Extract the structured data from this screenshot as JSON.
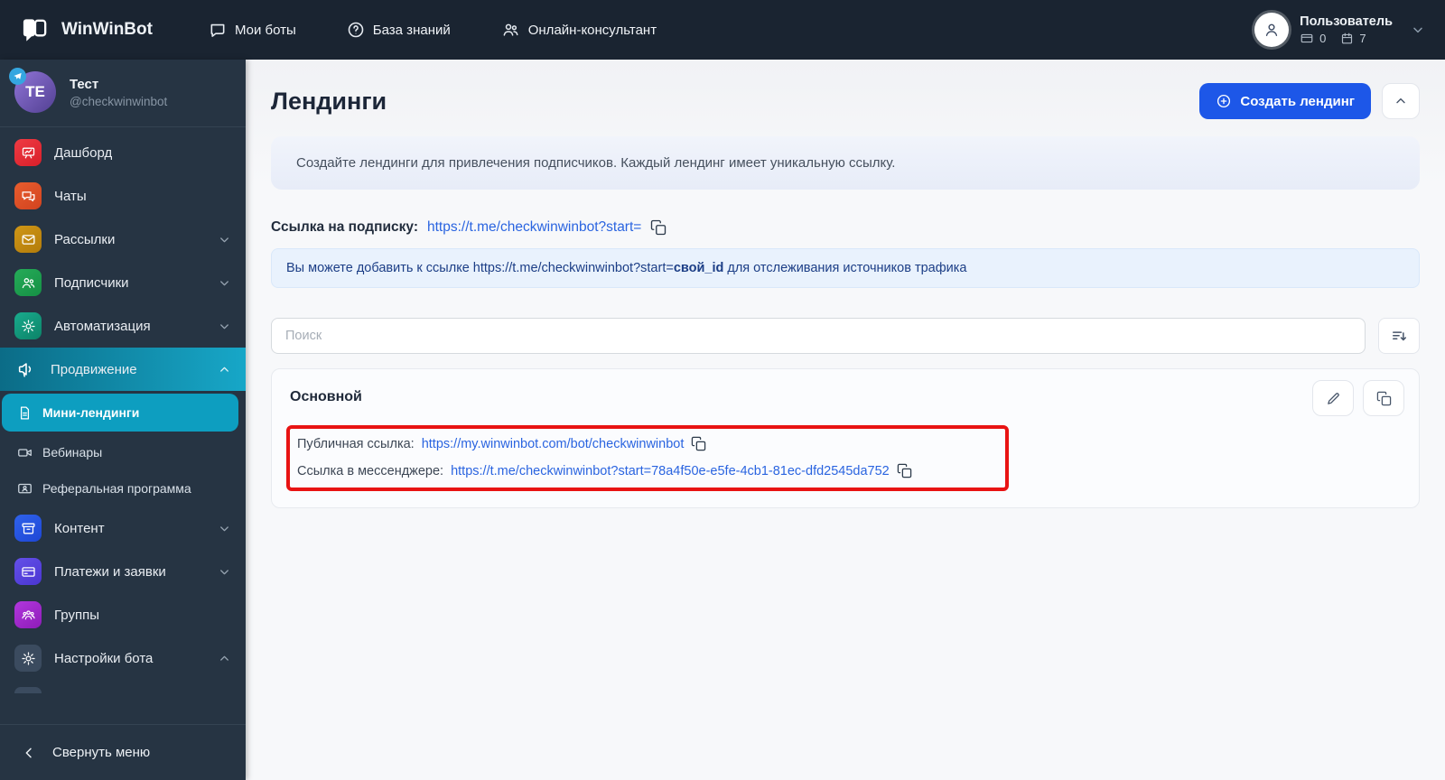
{
  "nav": {
    "brand": "WinWinBot",
    "items": [
      {
        "label": "Мои боты"
      },
      {
        "label": "База знаний"
      },
      {
        "label": "Онлайн-консультант"
      }
    ],
    "user": {
      "name": "Пользователь",
      "wallet_count": "0",
      "days_count": "7"
    }
  },
  "sidebar": {
    "profile": {
      "initials": "TE",
      "name": "Тест",
      "handle": "@checkwinwinbot"
    },
    "items": [
      {
        "label": "Дашборд"
      },
      {
        "label": "Чаты"
      },
      {
        "label": "Рассылки"
      },
      {
        "label": "Подписчики"
      },
      {
        "label": "Автоматизация"
      },
      {
        "label": "Продвижение"
      },
      {
        "label": "Контент"
      },
      {
        "label": "Платежи и заявки"
      },
      {
        "label": "Группы"
      },
      {
        "label": "Настройки бота"
      }
    ],
    "subitems": [
      {
        "label": "Мини-лендинги"
      },
      {
        "label": "Вебинары"
      },
      {
        "label": "Реферальная программа"
      }
    ],
    "collapse_label": "Свернуть меню"
  },
  "main": {
    "title": "Лендинги",
    "create_button": "Создать лендинг",
    "banner": "Создайте лендинги для привлечения подписчиков. Каждый лендинг имеет уникальную ссылку.",
    "subscription": {
      "label": "Ссылка на подписку:",
      "link": "https://t.me/checkwinwinbot?start="
    },
    "tip": {
      "prefix": "Вы можете добавить к ссылке https://t.me/checkwinwinbot?start=",
      "bold": "свой_id",
      "suffix": " для отслеживания источников трафика"
    },
    "search_placeholder": "Поиск",
    "card": {
      "title": "Основной",
      "public_label": "Публичная ссылка:",
      "public_link": "https://my.winwinbot.com/bot/checkwinwinbot",
      "messenger_label": "Ссылка в мессенджере:",
      "messenger_link": "https://t.me/checkwinwinbot?start=78a4f50e-e5fe-4cb1-81ec-dfd2545da752"
    }
  },
  "colors": {
    "accent": "#1d57e8",
    "link": "#2a64e0",
    "annotation_red": "#e81313",
    "active_teal": "#0d9ec0",
    "sidebar_bg": "#263443",
    "topbar_bg": "#1a2431"
  }
}
